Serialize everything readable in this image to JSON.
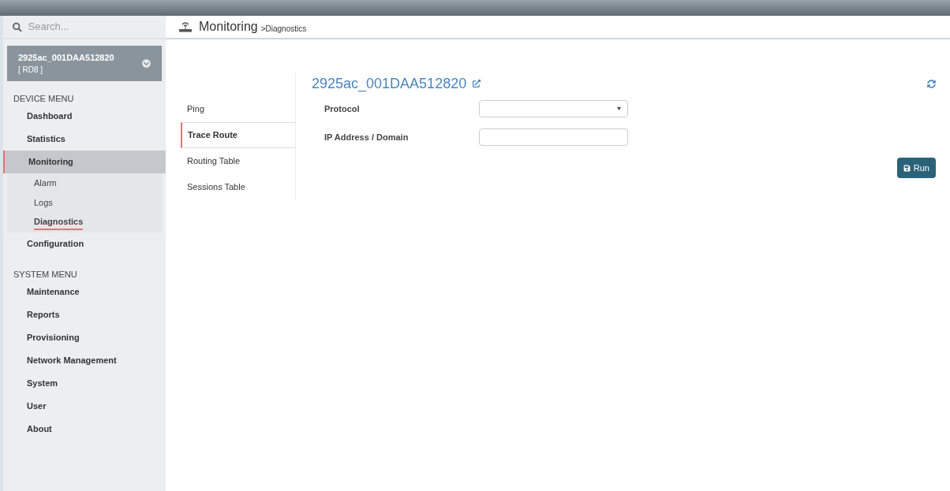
{
  "search": {
    "placeholder": "Search..."
  },
  "device": {
    "name": "2925ac_001DAA512820",
    "tag": "[ RD8 ]"
  },
  "menus": [
    {
      "heading": "DEVICE MENU",
      "items": [
        {
          "label": "Dashboard",
          "selected": false
        },
        {
          "label": "Statistics",
          "selected": false
        },
        {
          "label": "Monitoring",
          "selected": true,
          "children": [
            {
              "label": "Alarm",
              "selected": false
            },
            {
              "label": "Logs",
              "selected": false
            },
            {
              "label": "Diagnostics",
              "selected": true
            }
          ]
        },
        {
          "label": "Configuration",
          "selected": false
        }
      ]
    },
    {
      "heading": "SYSTEM MENU",
      "items": [
        {
          "label": "Maintenance",
          "selected": false
        },
        {
          "label": "Reports",
          "selected": false
        },
        {
          "label": "Provisioning",
          "selected": false
        },
        {
          "label": "Network Management",
          "selected": false
        },
        {
          "label": "System",
          "selected": false
        },
        {
          "label": "User",
          "selected": false
        },
        {
          "label": "About",
          "selected": false
        }
      ]
    }
  ],
  "breadcrumb": {
    "title": "Monitoring",
    "sub": ">Diagnostics"
  },
  "tabs": [
    {
      "label": "Ping",
      "selected": false
    },
    {
      "label": "Trace Route",
      "selected": true
    },
    {
      "label": "Routing Table",
      "selected": false
    },
    {
      "label": "Sessions Table",
      "selected": false
    }
  ],
  "panel": {
    "title": "2925ac_001DAA512820",
    "fields": [
      {
        "kind": "select",
        "label": "Protocol"
      },
      {
        "kind": "text",
        "label": "IP Address / Domain"
      }
    ],
    "run_button": "Run"
  }
}
